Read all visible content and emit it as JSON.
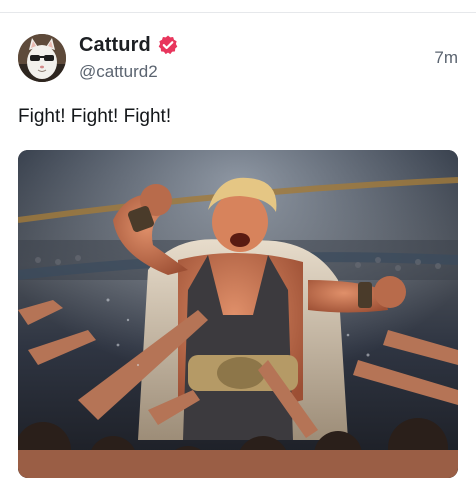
{
  "post": {
    "display_name": "Catturd",
    "handle": "@catturd2",
    "timestamp": "7m",
    "text": "Fight! Fight! Fight!",
    "verified_icon": "verified-badge-icon",
    "verified_color": "#e0245e",
    "media": {
      "description_icon": "wrestler-crowd-image"
    }
  }
}
